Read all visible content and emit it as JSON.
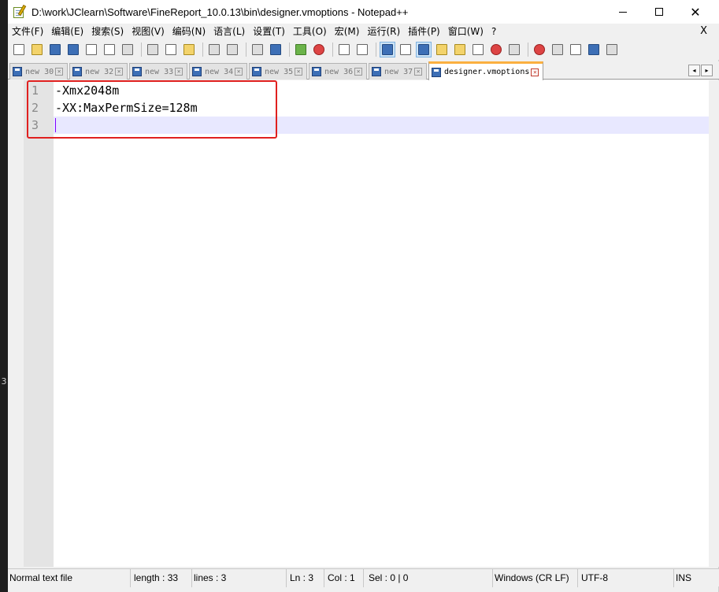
{
  "window": {
    "title": "D:\\work\\JClearn\\Software\\FineReport_10.0.13\\bin\\designer.vmoptions - Notepad++",
    "minimize": "—",
    "maximize": "☐",
    "close": "✕"
  },
  "left_strip": {
    "mark": "3"
  },
  "menu": {
    "items": [
      "文件(F)",
      "编辑(E)",
      "搜索(S)",
      "视图(V)",
      "编码(N)",
      "语言(L)",
      "设置(T)",
      "工具(O)",
      "宏(M)",
      "运行(R)",
      "插件(P)",
      "窗口(W)",
      "?"
    ],
    "close": "X"
  },
  "toolbar": {
    "buttons": [
      "new-file-icon",
      "open-file-icon",
      "save-icon",
      "save-all-icon",
      "close-icon",
      "close-all-icon",
      "print-icon",
      "cut-icon",
      "copy-icon",
      "paste-icon",
      "undo-icon",
      "redo-icon",
      "find-icon",
      "replace-icon",
      "zoom-in-icon",
      "zoom-out-icon",
      "sync-vertical-icon",
      "sync-horizontal-icon",
      "word-wrap-icon",
      "show-all-chars-icon",
      "indent-guide-icon",
      "user-lang-icon",
      "doc-map-icon",
      "function-list-icon",
      "folder-workspace-icon",
      "monitoring-icon",
      "record-macro-icon",
      "stop-macro-icon",
      "play-macro-icon",
      "run-macro-multiple-icon",
      "save-macro-icon"
    ]
  },
  "tabs": [
    {
      "label": "new 30"
    },
    {
      "label": "new 32"
    },
    {
      "label": "new 33"
    },
    {
      "label": "new 34"
    },
    {
      "label": "new 35"
    },
    {
      "label": "new 36"
    },
    {
      "label": "new 37"
    },
    {
      "label": "designer.vmoptions"
    }
  ],
  "tab_scroll": {
    "left": "◂",
    "right": "▸"
  },
  "tab_close_glyph": "✕",
  "editor": {
    "lines": [
      {
        "num": "1",
        "text": "-Xmx2048m"
      },
      {
        "num": "2",
        "text": "-XX:MaxPermSize=128m"
      },
      {
        "num": "3",
        "text": ""
      }
    ],
    "current_line": 3
  },
  "status": {
    "file_type": "Normal text file",
    "length": "length : 33",
    "lines": "lines : 3",
    "ln": "Ln : 3",
    "col": "Col : 1",
    "sel": "Sel : 0 | 0",
    "eol": "Windows (CR LF)",
    "encoding": "UTF-8",
    "mode": "INS"
  },
  "colors": {
    "highlight_box": "#e0201f",
    "current_line_bg": "#e8e8ff",
    "caret": "#8000ff",
    "active_tab_accent": "#fbb040"
  }
}
